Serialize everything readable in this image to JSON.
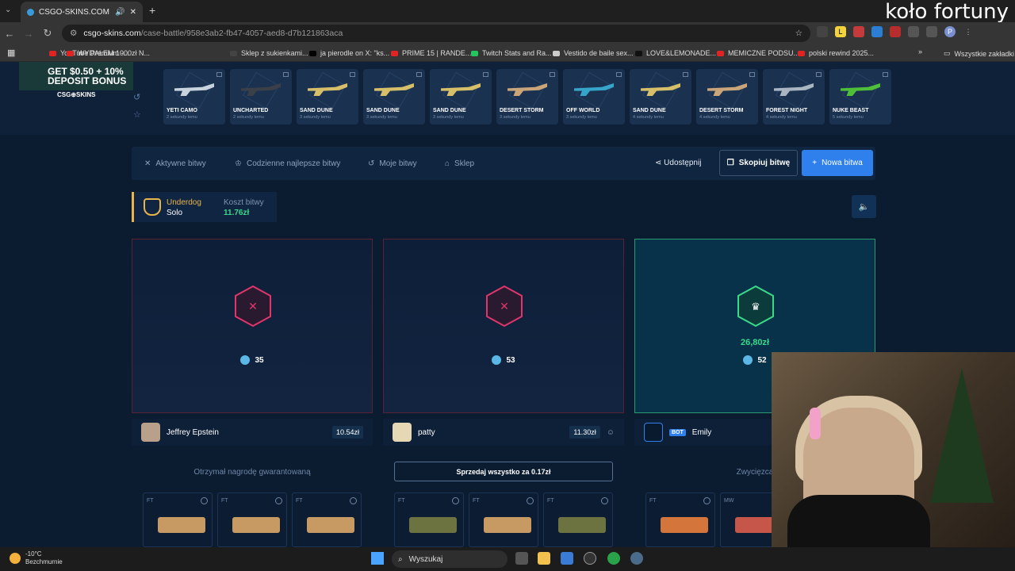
{
  "browser": {
    "tab_title": "CSGO-SKINS.COM - Najlep",
    "url_host": "csgo-skins.com",
    "url_path": "/case-battle/958e3ab2-fb47-4057-aed8-d7b121863aca",
    "overlay_text": "koło fortuny"
  },
  "bookmarks": [
    {
      "label": "YouTube Premium -...",
      "color": "#e02424"
    },
    {
      "label": "WYDAŁEM 1000zł N...",
      "color": "#e02424"
    },
    {
      "label": "Sklep z sukienkami...",
      "color": "#444444"
    },
    {
      "label": "ja pierodle on X: \"ks...",
      "color": "#000000"
    },
    {
      "label": "PRIME 15 | RANDE...",
      "color": "#e02424"
    },
    {
      "label": "Twitch Stats and Ra...",
      "color": "#22c55e"
    },
    {
      "label": "Vestido de baile sex...",
      "color": "#cccccc"
    },
    {
      "label": "LOVE&LEMONADE...",
      "color": "#111111"
    },
    {
      "label": "MEMICZNE PODSU...",
      "color": "#e02424"
    },
    {
      "label": "polski rewind 2025...",
      "color": "#e02424"
    }
  ],
  "bookmarks_all": "Wszystkie zakładki",
  "promo": {
    "line1": "GET $0.50 + 10%",
    "line2": "DEPOSIT BONUS",
    "logo": "CSG⊕SKINS"
  },
  "drops": [
    {
      "name": "YETI CAMO",
      "time": "2 sekundy temu",
      "color": "#c9d3de"
    },
    {
      "name": "UNCHARTED",
      "time": "2 sekundy temu",
      "color": "#3b3f47"
    },
    {
      "name": "SAND DUNE",
      "time": "3 sekundy temu",
      "color": "#d7bf6a"
    },
    {
      "name": "SAND DUNE",
      "time": "3 sekundy temu",
      "color": "#d7bf6a"
    },
    {
      "name": "SAND DUNE",
      "time": "3 sekundy temu",
      "color": "#d7bf6a"
    },
    {
      "name": "DESERT STORM",
      "time": "3 sekundy temu",
      "color": "#caa57a"
    },
    {
      "name": "OFF WORLD",
      "time": "3 sekundy temu",
      "color": "#37a4c9"
    },
    {
      "name": "SAND DUNE",
      "time": "4 sekundy temu",
      "color": "#d7bf6a"
    },
    {
      "name": "DESERT STORM",
      "time": "4 sekundy temu",
      "color": "#caa57a"
    },
    {
      "name": "FOREST NIGHT",
      "time": "4 sekundy temu",
      "color": "#a9b6c2"
    },
    {
      "name": "NUKE BEAST",
      "time": "5 sekundy temu",
      "color": "#4fbf3a"
    }
  ],
  "nav": {
    "active": "Aktywne bitwy",
    "daily": "Codzienne najlepsze bitwy",
    "mine": "Moje bitwy",
    "shop": "Sklep",
    "share": "Udostępnij",
    "copy": "Skopiuj bitwę",
    "new": "Nowa bitwa"
  },
  "battle": {
    "mode": "Underdog",
    "type": "Solo",
    "cost_label": "Koszt bitwy",
    "cost": "11.76zł"
  },
  "panels": [
    {
      "coins": "35",
      "result": "lose"
    },
    {
      "coins": "53",
      "result": "lose"
    },
    {
      "coins": "52",
      "result": "win",
      "win_amount": "26,80zł"
    }
  ],
  "players": [
    {
      "name": "Jeffrey Epstein",
      "value": "10.54zł",
      "avatar_color": "#b8a08a"
    },
    {
      "name": "patty",
      "value": "11.30zł",
      "avatar_color": "#e6d7b5"
    },
    {
      "name": "Emily",
      "bot": "BOT",
      "value": "",
      "avatar_color": "#0a1a2e"
    }
  ],
  "messages": {
    "p1": "Otrzymał nagrodę gwarantowaną",
    "p2": "Sprzedaj wszystko za 0.17zł",
    "p3": "Zwycięzca"
  },
  "items": [
    {
      "ext": "FT",
      "color": "#c79a63"
    },
    {
      "ext": "FT",
      "color": "#c79a63"
    },
    {
      "ext": "FT",
      "color": "#c79a63"
    },
    {
      "ext": "FT",
      "color": "#6c7340"
    },
    {
      "ext": "FT",
      "color": "#c79a63"
    },
    {
      "ext": "FT",
      "color": "#6c7340"
    },
    {
      "ext": "FT",
      "color": "#d4763c"
    },
    {
      "ext": "MW",
      "color": "#c6564a"
    }
  ],
  "taskbar": {
    "temp": "-10°C",
    "weather": "Bezchmurnie",
    "search": "Wyszukaj"
  }
}
